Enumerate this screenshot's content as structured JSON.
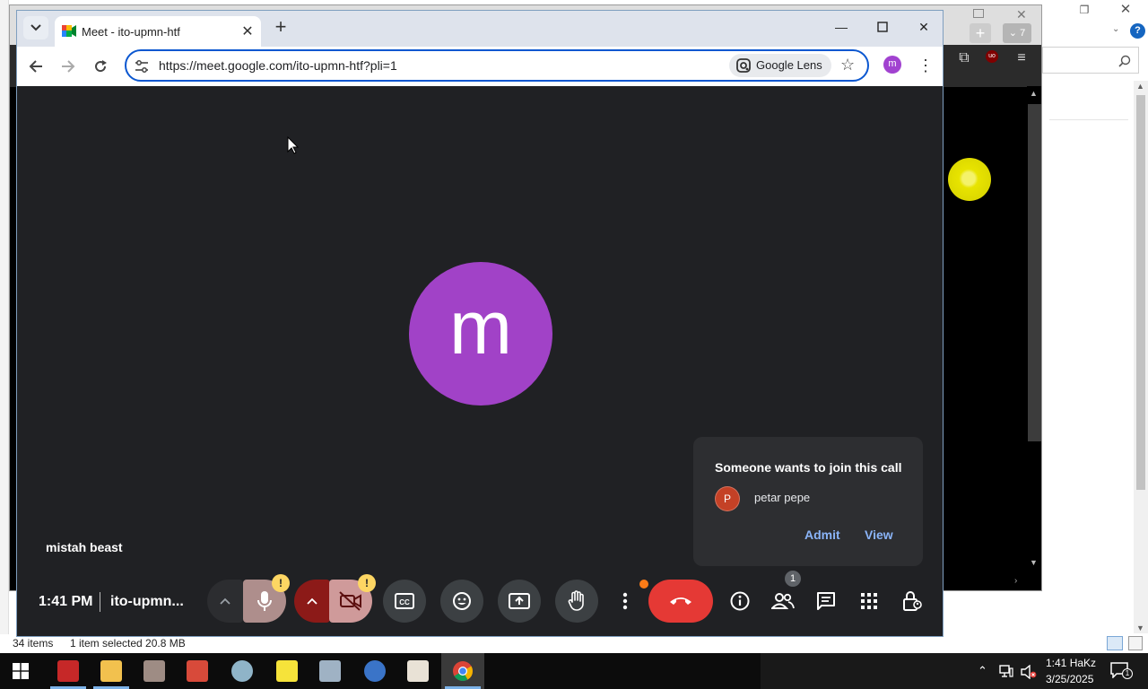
{
  "explorer": {
    "status_items": "34 items",
    "status_selection": "1 item selected  20.8 MB"
  },
  "bg_browser": {
    "tab_count": "7"
  },
  "chrome": {
    "tab_title": "Meet - ito-upmn-htf",
    "url": "https://meet.google.com/ito-upmn-htf?pli=1",
    "lens_label": "Google Lens",
    "profile_initial": "m"
  },
  "meet": {
    "avatar_initial": "m",
    "self_name": "mistah beast",
    "time": "1:41 PM",
    "meeting_code": "ito-upmn...",
    "participants_count": "1",
    "mic_warning": "!",
    "cam_warning": "!",
    "join_request": {
      "title": "Someone wants to join this call",
      "person_initial": "P",
      "person_name": "petar pepe",
      "admit_label": "Admit",
      "view_label": "View"
    },
    "colors": {
      "background": "#202124",
      "avatar": "#a142c7",
      "hangup": "#e53935",
      "link": "#8ab4f8"
    }
  },
  "taskbar": {
    "clock_time": "1:41 HaKz",
    "clock_date": "3/25/2025",
    "notification_count": "1",
    "apps": [
      "app-1",
      "file-explorer",
      "app-3",
      "app-4",
      "app-5",
      "spongebob-app",
      "app-7",
      "app-8",
      "java-app",
      "chrome"
    ]
  }
}
